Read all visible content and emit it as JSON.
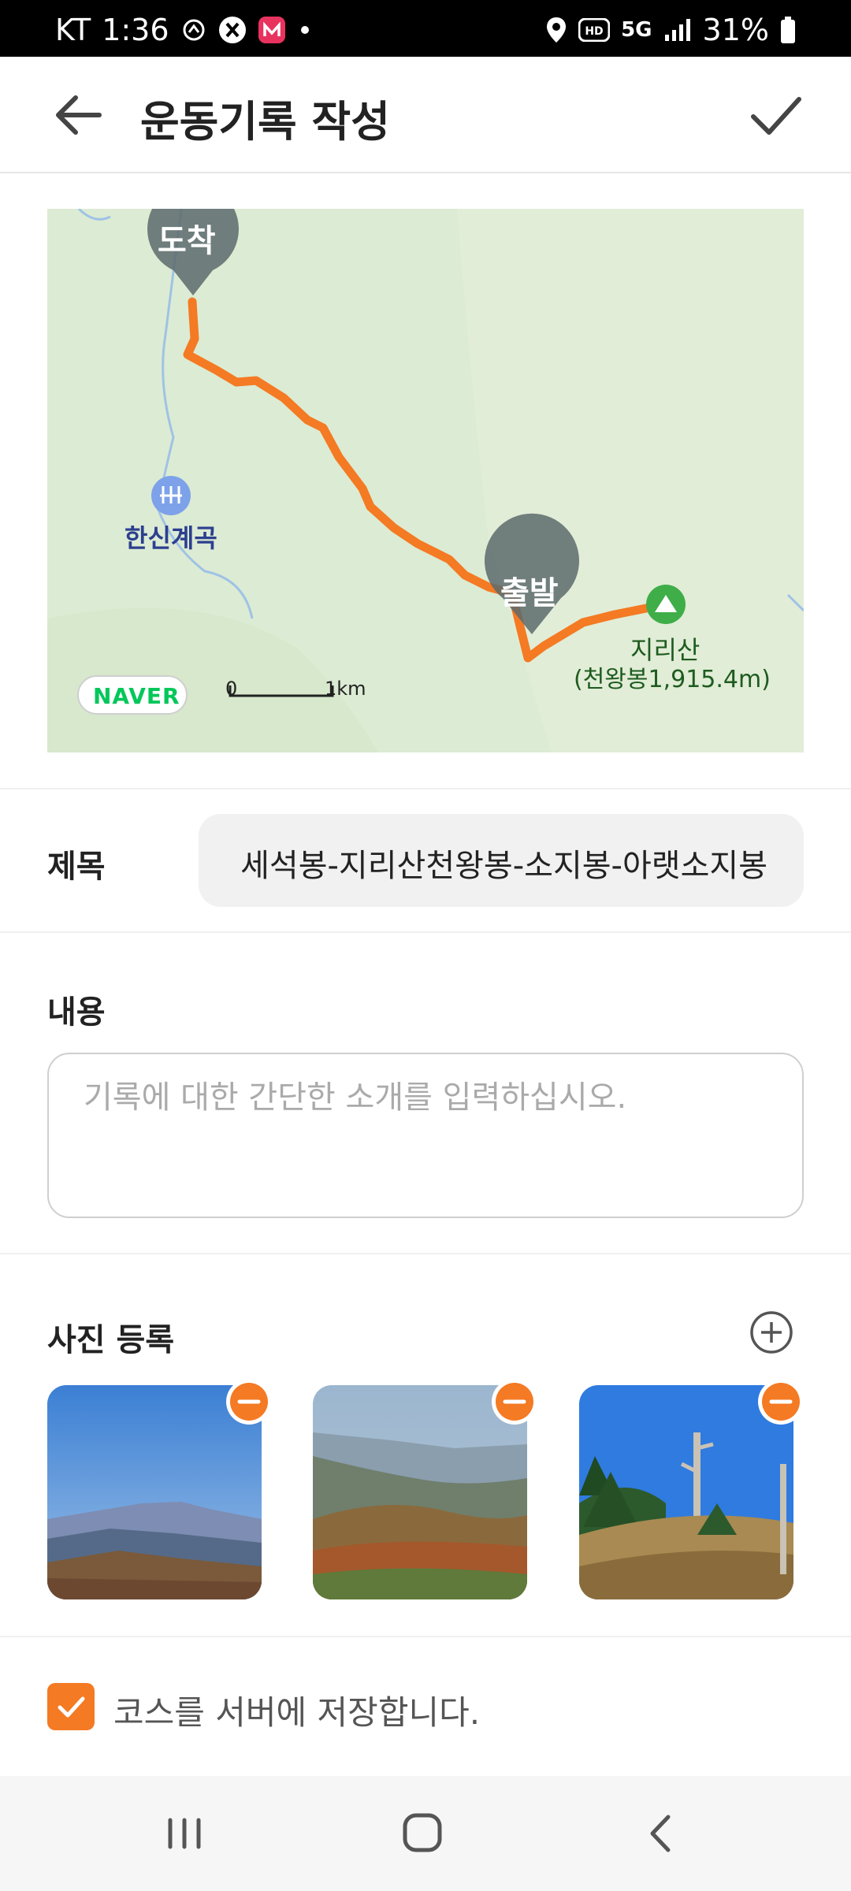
{
  "status_bar": {
    "carrier": "KT",
    "time": "1:36",
    "network": "5G",
    "battery": "31%"
  },
  "app_bar": {
    "title": "운동기록 작성"
  },
  "map": {
    "arrival_label": "도착",
    "start_label": "출발",
    "valley_label": "한신계곡",
    "peak_label_line1": "지리산",
    "peak_label_line2": "(천왕봉1,915.4m)",
    "brand": "NAVER",
    "scale_zero": "0",
    "scale_unit": "1km",
    "route_color": "#f47a23"
  },
  "form": {
    "title_label": "제목",
    "title_value": "세석봉-지리산천왕봉-소지봉-아랫소지봉",
    "content_label": "내용",
    "content_placeholder": "기록에 대한 간단한 소개를 입력하십시오.",
    "photos_label": "사진 등록",
    "save_course_label": "코스를 서버에 저장합니다."
  },
  "colors": {
    "accent": "#f47a23",
    "map_bg": "#dcebd3"
  }
}
